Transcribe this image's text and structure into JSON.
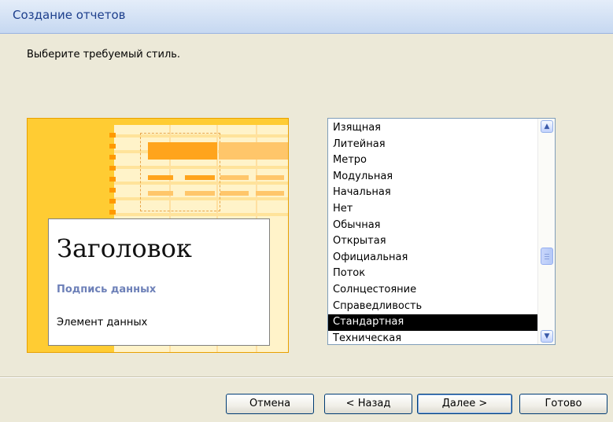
{
  "window": {
    "title": "Создание отчетов"
  },
  "prompt": "Выберите требуемый стиль.",
  "preview": {
    "heading": "Заголовок",
    "label": "Подпись данных",
    "item": "Элемент данных"
  },
  "styles": {
    "items": [
      "Изящная",
      "Литейная",
      "Метро",
      "Модульная",
      "Начальная",
      "Нет",
      "Обычная",
      "Открытая",
      "Официальная",
      "Поток",
      "Солнцестояние",
      "Справедливость",
      "Стандартная",
      "Техническая"
    ],
    "selected": "Стандартная"
  },
  "buttons": {
    "cancel": "Отмена",
    "back": "< Назад",
    "next": "Далее >",
    "finish": "Готово"
  },
  "colors": {
    "preview_accent": "#ffa41c",
    "selection": "#000000",
    "title_text": "#1d3f8c"
  }
}
